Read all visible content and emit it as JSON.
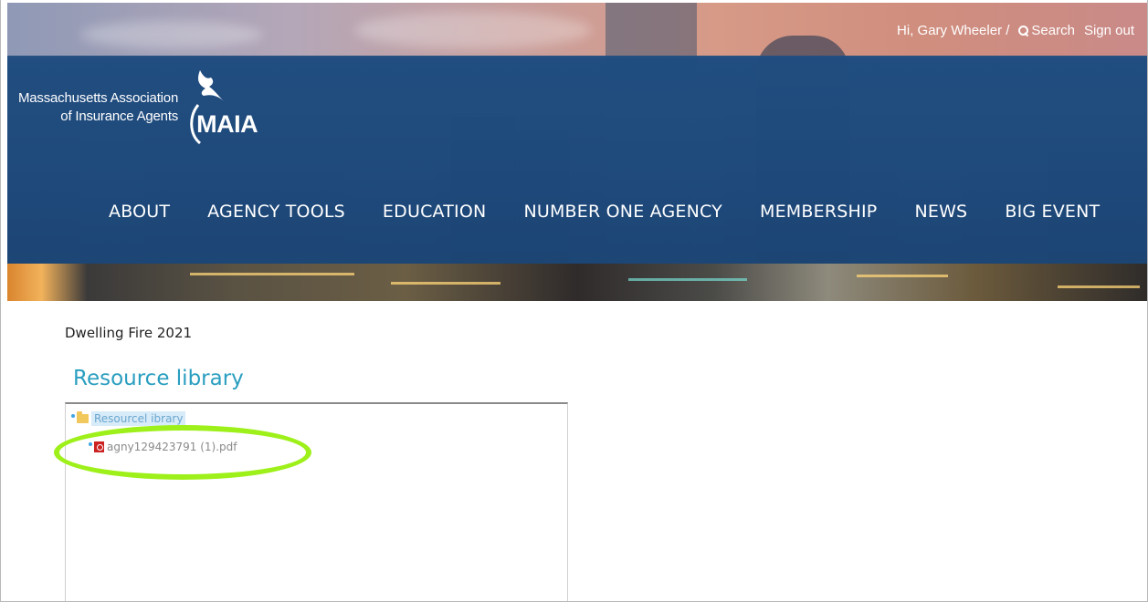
{
  "header": {
    "greeting": "Hi, Gary Wheeler /",
    "search_label": "Search",
    "signout_label": "Sign out"
  },
  "logo": {
    "line1": "Massachusetts Association",
    "line2": "of Insurance Agents",
    "wordmark": "MAIA"
  },
  "nav": {
    "items": [
      {
        "label": "ABOUT"
      },
      {
        "label": "AGENCY TOOLS"
      },
      {
        "label": "EDUCATION"
      },
      {
        "label": "NUMBER ONE AGENCY"
      },
      {
        "label": "MEMBERSHIP"
      },
      {
        "label": "NEWS"
      },
      {
        "label": "BIG EVENT"
      }
    ]
  },
  "content": {
    "page_heading": "Dwelling Fire 2021",
    "section_title": "Resource library",
    "tree": {
      "root_label": "Resourcel ibrary",
      "root_icon": "folder-icon",
      "file_label": "agny129423791 (1).pdf",
      "file_icon": "pdf-icon"
    }
  },
  "colors": {
    "nav_band": "#1f4a7d",
    "section_title": "#2a9ec0",
    "highlight": "#9ef01a",
    "pdf_icon": "#cc2222",
    "folder_icon": "#f1c85c"
  }
}
